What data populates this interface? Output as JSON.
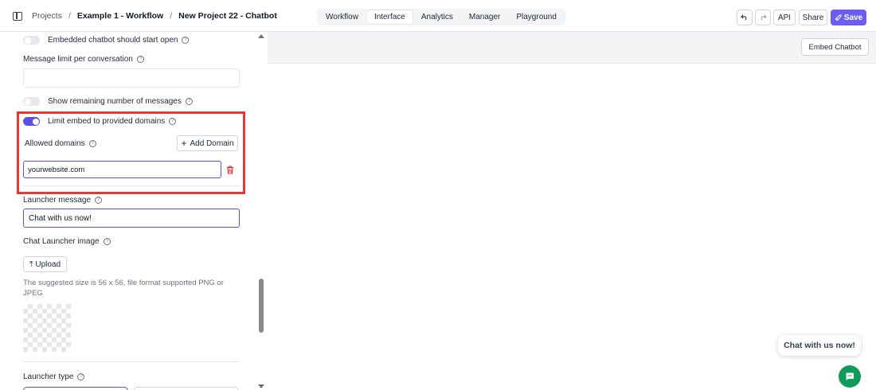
{
  "breadcrumb": {
    "projects": "Projects",
    "sep1": "/",
    "workflow": "Example 1 - Workflow",
    "sep2": "/",
    "project": "New Project 22 - Chatbot"
  },
  "tabs": [
    {
      "label": "Workflow",
      "active": false
    },
    {
      "label": "Interface",
      "active": true
    },
    {
      "label": "Analytics",
      "active": false
    },
    {
      "label": "Manager",
      "active": false
    },
    {
      "label": "Playground",
      "active": false
    }
  ],
  "toolbar": {
    "undo_icon": "undo-icon",
    "redo_icon": "redo-icon",
    "api": "API",
    "share": "Share",
    "save": "Save",
    "save_icon": "rocket-icon",
    "accent": "#6d5df0"
  },
  "settings": {
    "embedded_start_open": {
      "label": "Embedded chatbot should start open",
      "enabled": false
    },
    "message_limit": {
      "label": "Message limit per conversation",
      "value": ""
    },
    "show_remaining": {
      "label": "Show remaining number of messages",
      "enabled": false
    },
    "limit_domains": {
      "label": "Limit embed to provided domains",
      "enabled": true
    },
    "allowed_domains": {
      "label": "Allowed domains",
      "add_button": "Add Domain",
      "domains": [
        "yourwebsite.com"
      ]
    },
    "launcher_message": {
      "label": "Launcher message",
      "value": "Chat with us now!"
    },
    "launcher_image": {
      "label": "Chat Launcher image",
      "upload_button": "Upload",
      "hint": "The suggested size is 56 x 56, file format supported PNG or JPEG"
    },
    "launcher_type": {
      "label": "Launcher type"
    }
  },
  "preview": {
    "embed_button": "Embed Chatbot",
    "launcher_bubble": "Chat with us now!",
    "launcher_color": "#119a5a"
  },
  "help_glyph": "?",
  "highlight_color": "#e53935"
}
